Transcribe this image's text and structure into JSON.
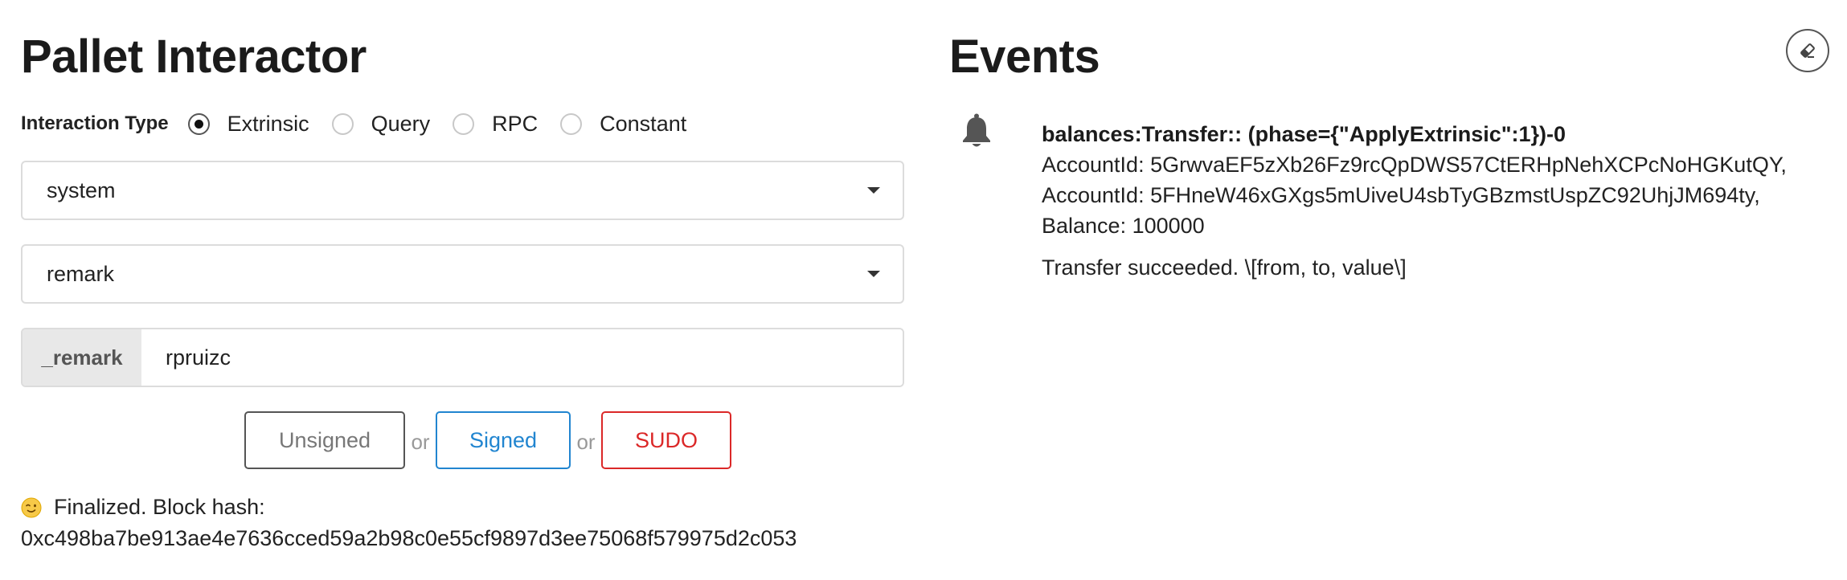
{
  "interactor": {
    "title": "Pallet Interactor",
    "interaction_type_label": "Interaction Type",
    "interaction_types": [
      {
        "label": "Extrinsic",
        "checked": true
      },
      {
        "label": "Query",
        "checked": false
      },
      {
        "label": "RPC",
        "checked": false
      },
      {
        "label": "Constant",
        "checked": false
      }
    ],
    "pallet_select": "system",
    "callable_select": "remark",
    "param_label": "_remark",
    "param_value": "rpruizc",
    "buttons": {
      "unsigned": "Unsigned",
      "signed": "Signed",
      "sudo": "SUDO",
      "or": "or"
    },
    "status": {
      "emoji_icon": "winking-face-icon",
      "line1": "Finalized. Block hash:",
      "hash": "0xc498ba7be913ae4e7636cced59a2b98c0e55cf9897d3ee75068f579975d2c053"
    }
  },
  "events": {
    "title": "Events",
    "clear_icon": "eraser-icon",
    "items": [
      {
        "icon": "bell-icon",
        "title": "balances:Transfer:: (phase={\"ApplyExtrinsic\":1})-0",
        "lines": [
          "AccountId: 5GrwvaEF5zXb26Fz9rcQpDWS57CtERHpNehXCPcNoHGKutQY,",
          "AccountId: 5FHneW46xGXgs5mUiveU4sbTyGBzmstUspZC92UhjJM694ty,",
          "Balance: 100000"
        ],
        "description": "Transfer succeeded. \\[from, to, value\\]"
      }
    ]
  },
  "colors": {
    "signed": "#2185d0",
    "sudo": "#db2828",
    "unsigned_border": "#555555"
  }
}
